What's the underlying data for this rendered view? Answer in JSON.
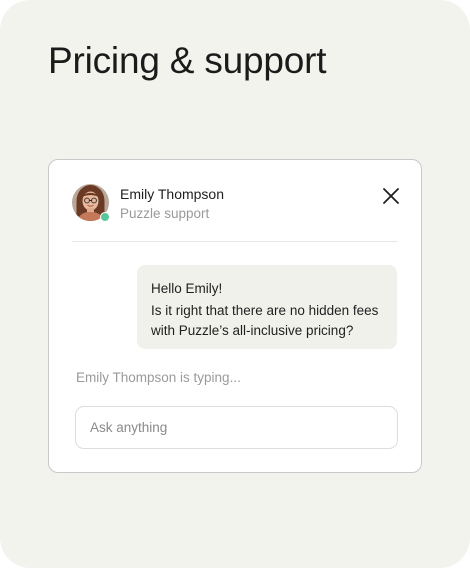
{
  "page": {
    "title": "Pricing & support"
  },
  "chat": {
    "agent": {
      "name": "Emily Thompson",
      "role": "Puzzle support",
      "status": "online",
      "status_color": "#5ac79a"
    },
    "close_icon": "close-icon",
    "messages": [
      {
        "lines": [
          "Hello Emily!",
          "Is it right that there are no hidden fees",
          "with Puzzle’s all-inclusive pricing?"
        ]
      }
    ],
    "typing_text": "Emily Thompson is typing...",
    "input": {
      "value": "",
      "placeholder": "Ask anything"
    }
  },
  "colors": {
    "page_background": "#f3f3ee",
    "card_background": "#ffffff",
    "bubble_background": "#f1f1ec",
    "muted_text": "#9a9a9a"
  }
}
